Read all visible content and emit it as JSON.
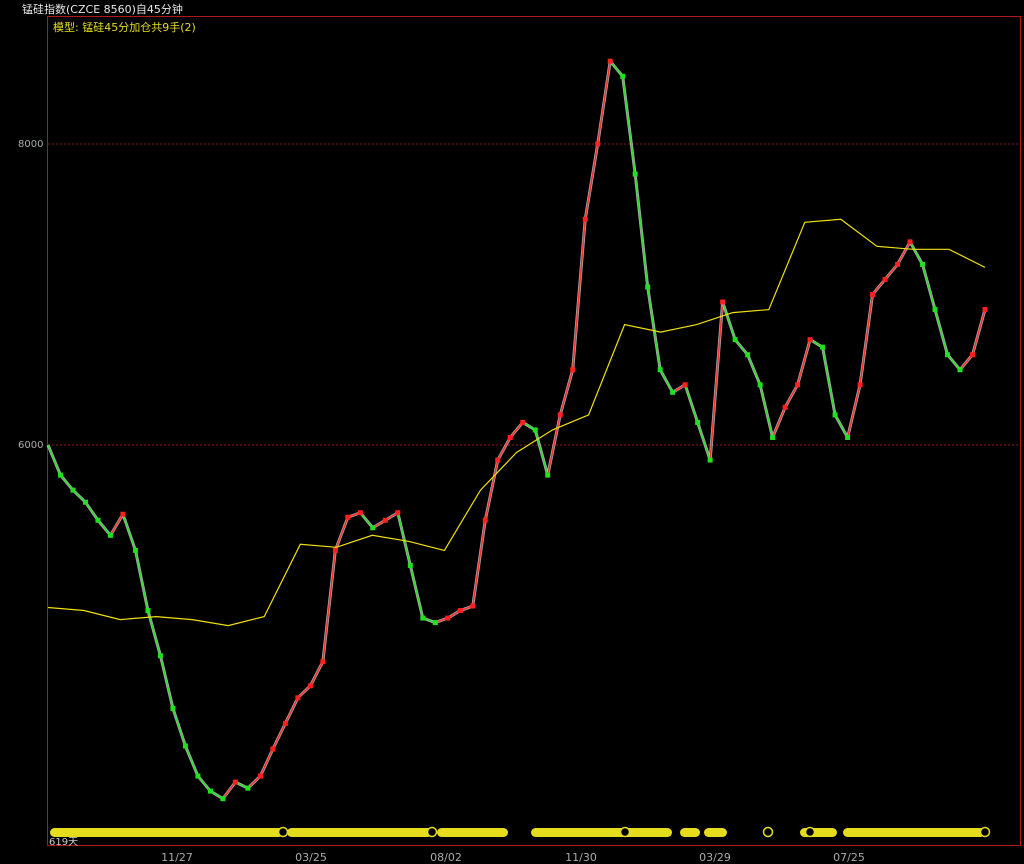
{
  "window": {
    "title": "锰硅指数(CZCE 8560)自45分钟",
    "model_label": "模型: 锰硅45分加仓共9手(2)",
    "bar_count": "619天"
  },
  "colors": {
    "background": "#000000",
    "frame": "#b01818",
    "grid": "#8a1a1a",
    "price_line": "#c8c8c8",
    "up_segment": "#ff2020",
    "down_segment": "#20e020",
    "model_line": "#f0e010",
    "signal_bar": "#e6dc1e"
  },
  "chart_data": {
    "type": "line",
    "y_ticks": [
      "8000",
      "6000"
    ],
    "x_ticks": [
      "11/27",
      "03/25",
      "08/02",
      "11/30",
      "03/29",
      "07/25"
    ],
    "series": [
      {
        "values": [
          6000,
          5800,
          5700,
          5620,
          5500,
          5400,
          5540,
          5300,
          4900,
          4600,
          4250,
          4000,
          3800,
          3700,
          3650,
          3760,
          3720,
          3800,
          3980,
          4150,
          4320,
          4400,
          4560,
          5300,
          5520,
          5550,
          5450,
          5500,
          5550,
          5200,
          4850,
          4820,
          4850,
          4900,
          4930,
          5500,
          5900,
          6050,
          6150,
          6100,
          5800,
          6200,
          6500,
          7500,
          8000,
          8550,
          8450,
          7800,
          7050,
          6500,
          6350,
          6400,
          6150,
          5900,
          6950,
          6700,
          6600,
          6400,
          6050,
          6250,
          6400,
          6700,
          6650,
          6200,
          6050,
          6400,
          7000,
          7100,
          7200,
          7350,
          7200,
          6900,
          6600,
          6500,
          6600,
          6900
        ]
      },
      {
        "values": [
          4920,
          4900,
          4840,
          4860,
          4840,
          4800,
          4860,
          5340,
          5320,
          5400,
          5360,
          5300,
          5700,
          5950,
          6100,
          6200,
          6800,
          6750,
          6800,
          6880,
          6900,
          7480,
          7500,
          7320,
          7300,
          7300,
          7180
        ]
      }
    ]
  }
}
